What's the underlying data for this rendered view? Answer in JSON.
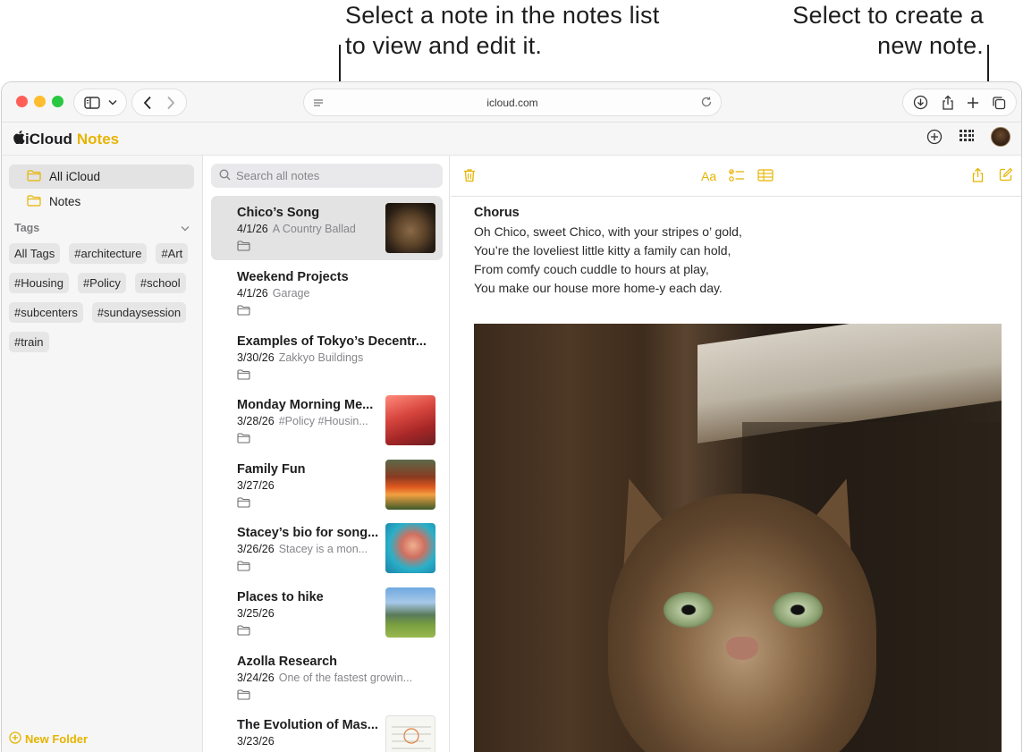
{
  "callouts": {
    "left": "Select a note in the notes list to view and edit it.",
    "right": "Select to create a new note."
  },
  "browser": {
    "url": "icloud.com"
  },
  "app": {
    "brand": "iCloud",
    "brand_accent": "Notes",
    "accent_color": "#e6b400"
  },
  "sidebar": {
    "folders": [
      {
        "label": "All iCloud",
        "selected": true
      },
      {
        "label": "Notes",
        "selected": false
      }
    ],
    "tags_header": "Tags",
    "tags": [
      "All Tags",
      "#architecture",
      "#Art",
      "#Housing",
      "#Policy",
      "#school",
      "#subcenters",
      "#sundaysession",
      "#train"
    ],
    "new_folder": "New Folder"
  },
  "notes_list": {
    "search_placeholder": "Search all notes",
    "items": [
      {
        "title": "Chico’s Song",
        "date": "4/1/26",
        "preview": "A Country Ballad",
        "thumbnail": "cat",
        "selected": true
      },
      {
        "title": "Weekend Projects",
        "date": "4/1/26",
        "preview": "Garage",
        "thumbnail": null
      },
      {
        "title": "Examples of Tokyo’s Decentr...",
        "date": "3/30/26",
        "preview": "Zakkyo Buildings",
        "thumbnail": null
      },
      {
        "title": "Monday Morning Me...",
        "date": "3/28/26",
        "preview": "#Policy #Housin...",
        "thumbnail": "red-building"
      },
      {
        "title": "Family Fun",
        "date": "3/27/26",
        "preview": "",
        "thumbnail": "campfire"
      },
      {
        "title": "Stacey’s bio for song...",
        "date": "3/26/26",
        "preview": "Stacey is a mon...",
        "thumbnail": "portrait"
      },
      {
        "title": "Places to hike",
        "date": "3/25/26",
        "preview": "",
        "thumbnail": "mountains"
      },
      {
        "title": "Azolla Research",
        "date": "3/24/26",
        "preview": "One of the fastest growin...",
        "thumbnail": null
      },
      {
        "title": "The Evolution of Mas...",
        "date": "3/23/26",
        "preview": "",
        "thumbnail": "document"
      }
    ]
  },
  "editor": {
    "heading": "Chorus",
    "lines": [
      "Oh Chico, sweet Chico, with your stripes o’ gold,",
      "You’re the loveliest little kitty a family can hold,",
      "From comfy couch cuddle to hours at play,",
      "You make our house more home-y each day."
    ],
    "format_label": "Aa"
  }
}
